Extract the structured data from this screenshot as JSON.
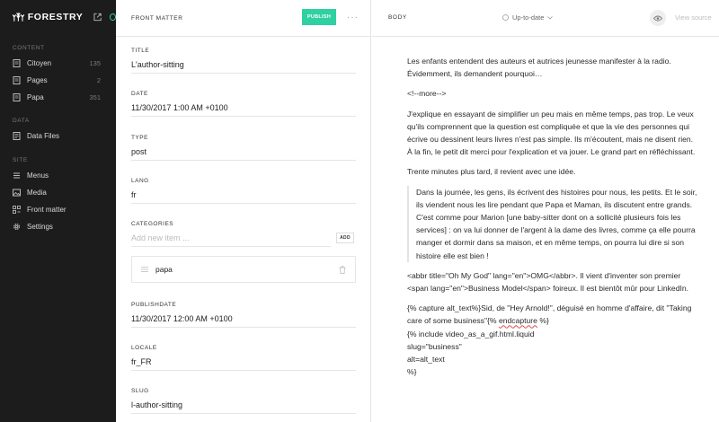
{
  "sidebar": {
    "brand": "FORESTRY",
    "sections": {
      "content": "CONTENT",
      "data": "DATA",
      "site": "SITE"
    },
    "content_items": [
      {
        "label": "Citoyen",
        "count": "135",
        "icon": "document-icon"
      },
      {
        "label": "Pages",
        "count": "2",
        "icon": "document-icon"
      },
      {
        "label": "Papa",
        "count": "351",
        "icon": "document-icon"
      }
    ],
    "data_items": [
      {
        "label": "Data Files",
        "icon": "data-file-icon"
      }
    ],
    "site_items": [
      {
        "label": "Menus",
        "icon": "menu-icon"
      },
      {
        "label": "Media",
        "icon": "image-icon"
      },
      {
        "label": "Front matter",
        "icon": "front-matter-icon"
      },
      {
        "label": "Settings",
        "icon": "gear-icon"
      }
    ]
  },
  "front_matter": {
    "title": "FRONT MATTER",
    "publish_label": "PUBLISH",
    "more_label": "···",
    "fields": {
      "title": {
        "label": "TITLE",
        "value": "L'author-sitting"
      },
      "date": {
        "label": "DATE",
        "value": "11/30/2017 1:00 AM +0100"
      },
      "type": {
        "label": "TYPE",
        "value": "post"
      },
      "lang": {
        "label": "LANG",
        "value": "fr"
      },
      "categories": {
        "label": "CATEGORIES",
        "placeholder": "Add new item ...",
        "add_label": "ADD",
        "items": [
          "papa"
        ]
      },
      "publishdate": {
        "label": "PUBLISHDATE",
        "value": "11/30/2017 12:00 AM +0100"
      },
      "locale": {
        "label": "LOCALE",
        "value": "fr_FR"
      },
      "slug": {
        "label": "SLUG",
        "value": "l-author-sitting"
      }
    }
  },
  "body": {
    "title": "BODY",
    "sync_status": "Up-to-date",
    "view_source": "View source",
    "paragraphs": {
      "p1": "Les enfants entendent des auteurs et autrices jeunesse manifester à la radio. Évidemment, ils demandent pourquoi…",
      "p2": "<!--more-->",
      "p3": "J'explique en essayant de simplifier un peu mais en même temps, pas trop. Le veux qu'ils comprennent que la question est compliquée et que la vie des personnes qui écrive ou dessinent leurs livres n'est pas simple. Ils m'écoutent, mais ne disent rien. À la fin, le petit dit merci pour l'explication et va jouer. Le grand part en réfléchissant.",
      "p4": "Trente minutes plus tard, il revient avec une idée.",
      "quote": "Dans la journée, les gens, ils écrivent des histoires pour nous, les petits. Et le soir, ils viendent nous les lire pendant que Papa et Maman, ils discutent entre grands. C'est comme pour Marion [une baby-sitter dont on a sollicité plusieurs fois les services] : on va lui donner de l'argent à la dame des livres, comme ça elle pourra manger et dormir dans sa maison, et en même temps, on pourra lui dire si son histoire elle est bien !",
      "p5": "<abbr title=\"Oh My God\" lang=\"en\">OMG</abbr>. Il vient d'inventer son premier <span lang=\"en\">Business Model</span> foireux. Il est bientôt mûr pour LinkedIn.",
      "code_line1_a": "{% capture alt_text%}Sid, de \"Hey Arnold!\", déguisé en homme d'affaire, dit \"Taking care of some business\"{% ",
      "code_line1_b": "endcapture",
      "code_line1_c": " %}",
      "code_line2": "{% include video_as_a_gif.html.liquid",
      "code_line3": "slug=\"business\"",
      "code_line4": "alt=alt_text",
      "code_line5": "%}"
    }
  },
  "colors": {
    "sidebar_bg": "#1c1c1c",
    "accent": "#2fd0a1"
  }
}
